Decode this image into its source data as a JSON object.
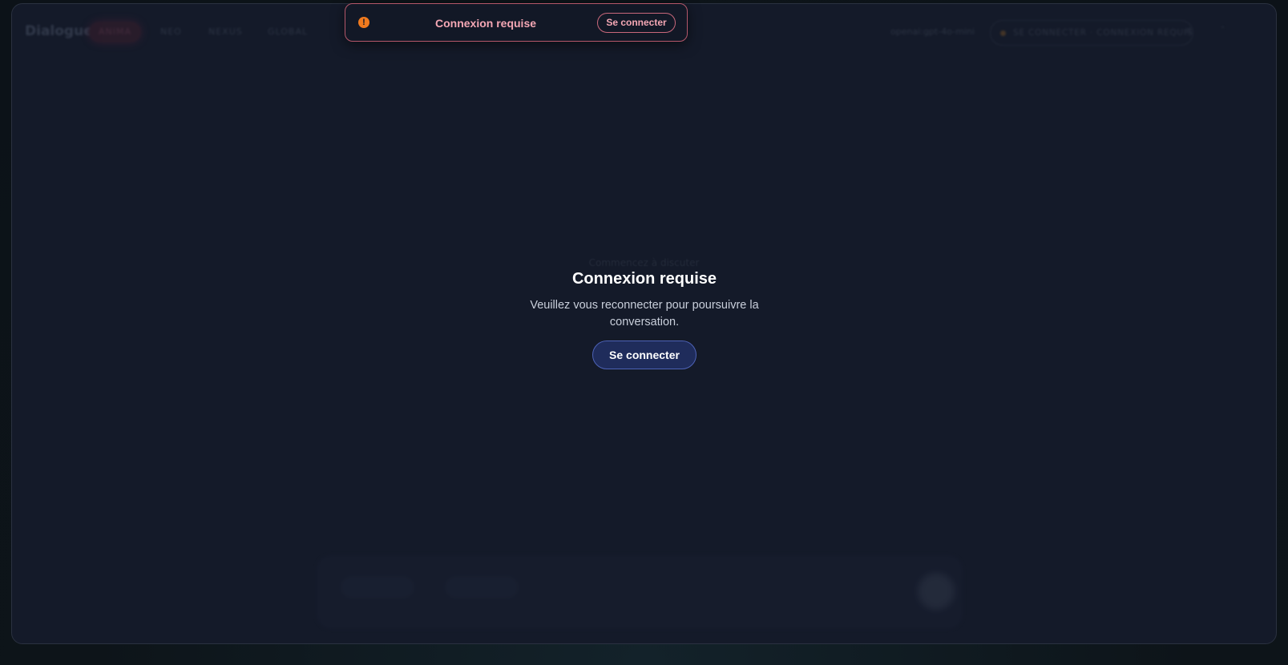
{
  "header": {
    "brand": "Dialogue",
    "tabs": [
      {
        "label": "ANIMA",
        "active": true
      },
      {
        "label": "NEO",
        "active": false
      },
      {
        "label": "NEXUS",
        "active": false
      },
      {
        "label": "GLOBAL",
        "active": false
      }
    ],
    "model": "openai:gpt-4o-mini",
    "status": "SE CONNECTER · CONNEXION REQUISE"
  },
  "main": {
    "empty_hint": "Commencez à discuter"
  },
  "toast": {
    "message": "Connexion requise",
    "button_label": "Se connecter",
    "icon": "alert-circle-icon",
    "icon_glyph": "!",
    "accent": "#f07a1e"
  },
  "modal": {
    "title": "Connexion requise",
    "text": "Veuillez vous reconnecter pour poursuivre la conversation.",
    "button_label": "Se connecter",
    "accent": "#1f2c5b"
  }
}
